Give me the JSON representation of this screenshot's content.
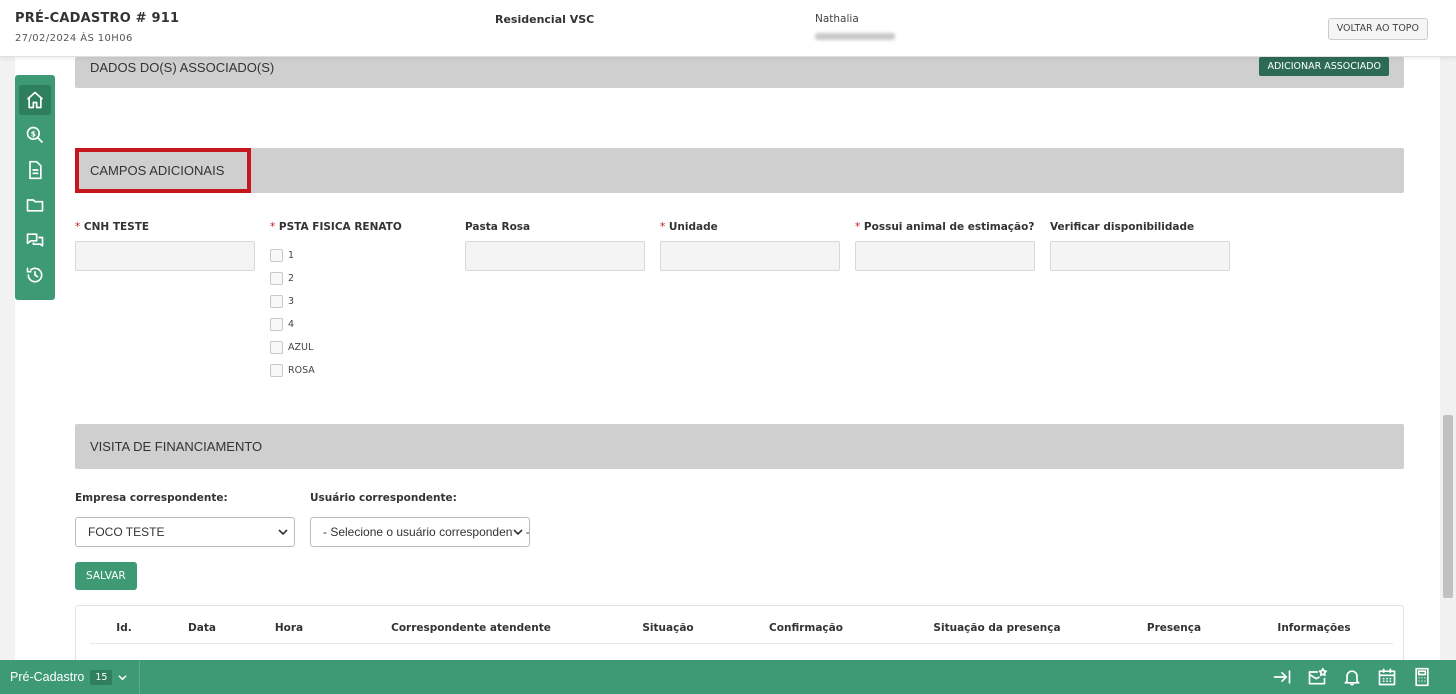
{
  "header": {
    "title": "PRÉ-CADASTRO # 911",
    "date": "27/02/2024 ÀS 10H06",
    "empreendimento": "Residencial VSC",
    "user_name": "Nathalia",
    "back_to_top_label": "VOLTAR AO TOPO"
  },
  "sidebar": {
    "items": [
      {
        "icon": "home-icon",
        "active": true
      },
      {
        "icon": "dollar-search-icon"
      },
      {
        "icon": "document-icon"
      },
      {
        "icon": "folder-icon"
      },
      {
        "icon": "chat-icon"
      },
      {
        "icon": "history-icon"
      }
    ]
  },
  "section_associados": {
    "title": "DADOS DO(S) ASSOCIADO(S)",
    "add_button_label": "ADICIONAR ASSOCIADO"
  },
  "section_campos": {
    "title": "CAMPOS ADICIONAIS",
    "highlight_color": "#c5161d",
    "fields": {
      "cnh": {
        "label": "CNH TESTE",
        "required_mark": "*",
        "value": ""
      },
      "psta": {
        "label": "PSTA FISICA RENATO",
        "required_mark": "*",
        "options": [
          "1",
          "2",
          "3",
          "4",
          "AZUL",
          "ROSA"
        ]
      },
      "pasta_rosa": {
        "label": "Pasta Rosa",
        "value": ""
      },
      "unidade": {
        "label": "Unidade",
        "required_mark": "*",
        "value": ""
      },
      "animal": {
        "label": "Possui animal de estimação?",
        "required_mark": "*",
        "value": ""
      },
      "disponibilidade": {
        "label": "Verificar disponibilidade",
        "value": ""
      }
    }
  },
  "section_visita": {
    "title": "VISITA DE FINANCIAMENTO",
    "empresa_label": "Empresa correspondente:",
    "empresa_value": "FOCO TESTE",
    "usuario_label": "Usuário correspondente:",
    "usuario_value": "- Selecione o usuário correspondente -",
    "save_label": "SALVAR",
    "table_headers": [
      "Id.",
      "Data",
      "Hora",
      "Correspondente atendente",
      "Situação",
      "Confirmação",
      "Situação da presença",
      "Presença",
      "Informações"
    ]
  },
  "bottombar": {
    "tab_label": "Pré-Cadastro",
    "tab_count": "15",
    "icons": [
      "arrow-to-right-icon",
      "mail-star-icon",
      "bell-icon",
      "calendar-icon",
      "calculator-icon"
    ]
  },
  "colors": {
    "brand_green": "#3d9a74",
    "dark_green": "#2d6b57",
    "section_gray": "#cfcfcf",
    "required_red": "#c5161d"
  }
}
